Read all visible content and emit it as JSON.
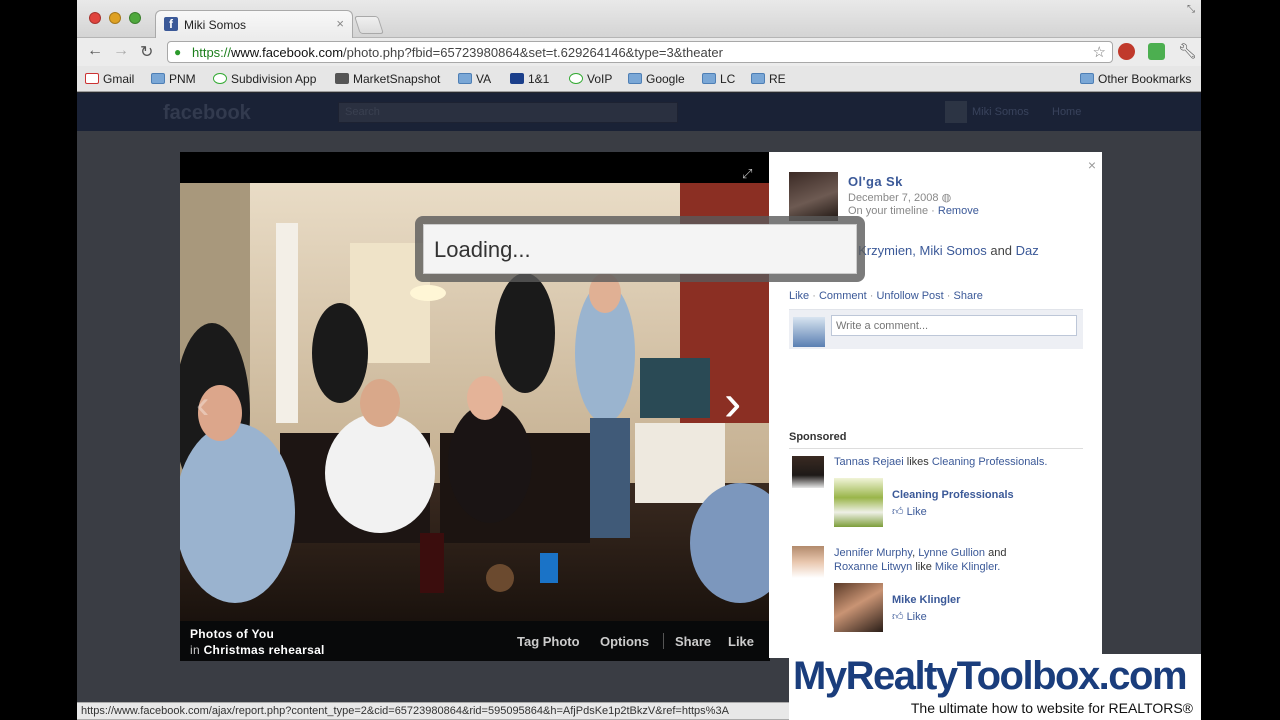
{
  "browser": {
    "tab_title": "Miki Somos",
    "tab_close": "×",
    "url_scheme": "https://",
    "url_domain": "www.facebook.com",
    "url_path": "/photo.php?fbid=65723980864&set=t.629264146&type=3&theater",
    "back_icon": "←",
    "forward_icon": "→",
    "reload_icon": "↻",
    "star_icon": "☆",
    "lock_icon": "🔒",
    "bookmarks": [
      {
        "label": "Gmail",
        "icon": "gmail-icon"
      },
      {
        "label": "PNM",
        "icon": "folder-icon"
      },
      {
        "label": "Subdivision App",
        "icon": "site-icon"
      },
      {
        "label": "MarketSnapshot",
        "icon": "site-icon"
      },
      {
        "label": "VA",
        "icon": "folder-icon"
      },
      {
        "label": "1&1",
        "icon": "site-icon"
      },
      {
        "label": "VoIP",
        "icon": "site-icon"
      },
      {
        "label": "Google",
        "icon": "folder-icon"
      },
      {
        "label": "LC",
        "icon": "folder-icon"
      },
      {
        "label": "RE",
        "icon": "folder-icon"
      }
    ],
    "other_bookmarks": "Other Bookmarks",
    "status_url": "https://www.facebook.com/ajax/report.php?content_type=2&cid=65723980864&rid=595095864&h=AfjPdsKe1p2tBkzV&ref=https%3A"
  },
  "facebook": {
    "logo": "facebook",
    "search_placeholder": "Search",
    "user_name": "Miki Somos",
    "home": "Home"
  },
  "photo": {
    "album_line1": "Photos of You",
    "album_in": "in",
    "album_name": "Christmas rehearsal",
    "actions": [
      "Tag Photo",
      "Options",
      "Share",
      "Like"
    ],
    "loading": "Loading...",
    "prev_icon": "‹",
    "next_icon": "›",
    "expand_icon": "⤢"
  },
  "panel": {
    "close": "×",
    "poster_name": "Ol'ga Sk",
    "date": "December 7, 2008",
    "timeline_text": "On your timeline ·",
    "remove": "Remove",
    "with_partial": "z Krzymien,",
    "with_name2": "Miki Somos",
    "with_and": "and",
    "with_name3": "Daz",
    "actions": [
      "Like",
      "Comment",
      "Unfollow Post",
      "Share"
    ],
    "comment_placeholder": "Write a comment...",
    "sponsored": "Sponsored",
    "ads": [
      {
        "actor": "Tannas Rejaei",
        "verb": "likes",
        "target": "Cleaning Professionals.",
        "title": "Cleaning Professionals",
        "like": "Like"
      },
      {
        "actor": "Jennifer Murphy",
        "actor2": "Lynne Gullion",
        "and": "and",
        "actor3": "Roxanne Litwyn",
        "verb": "like",
        "target": "Mike Klingler.",
        "title": "Mike Klingler",
        "like": "Like"
      }
    ]
  },
  "overlay": {
    "brand": "MyRealtyToolbox.com",
    "tagline": "The ultimate how to website for REALTORS®"
  }
}
